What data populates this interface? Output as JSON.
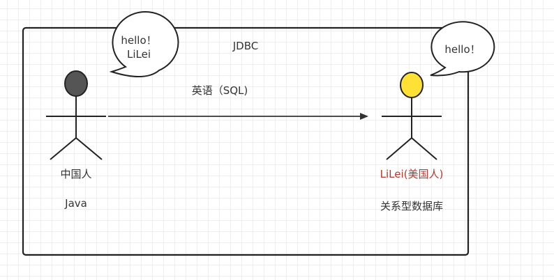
{
  "diagram": {
    "header": "JDBC",
    "arrow_label": "英语（SQL)",
    "left_actor": {
      "name": "中国人",
      "role": "Java",
      "speech": [
        "hello！",
        "LiLei"
      ],
      "head_color": "#555555"
    },
    "right_actor": {
      "name": "LiLei(美国人)",
      "role": "关系型数据库",
      "speech": [
        "hello！"
      ],
      "head_color": "#FFE135",
      "name_color": "#B5382E"
    }
  }
}
